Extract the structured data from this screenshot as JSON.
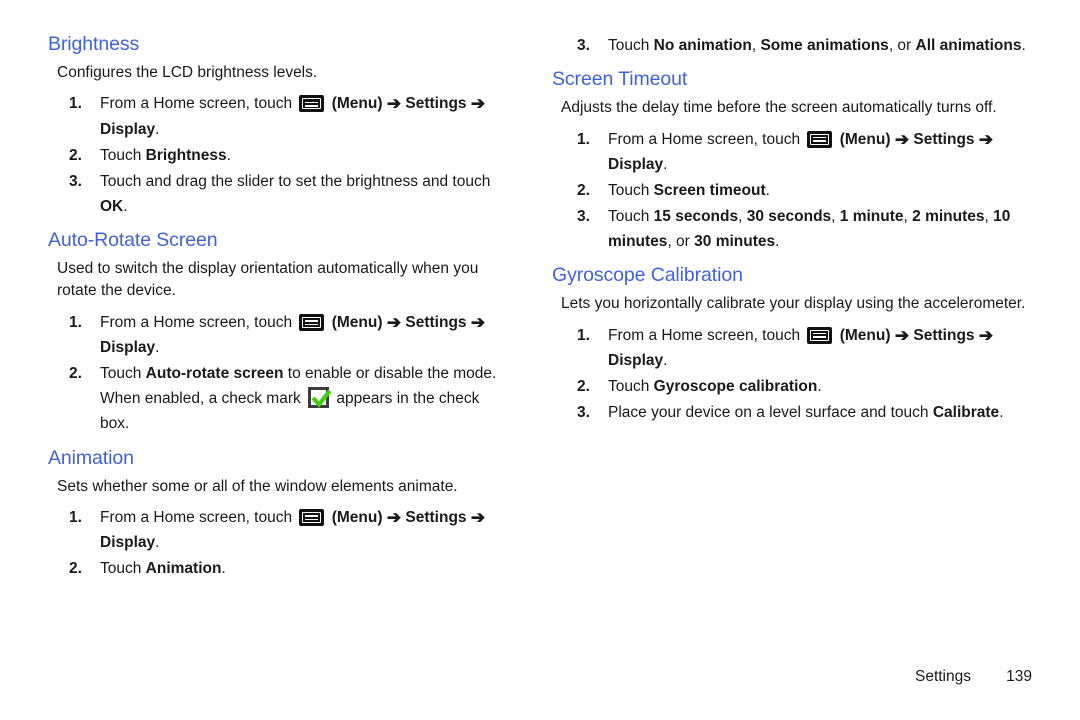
{
  "document": {
    "footer": {
      "section_label": "Settings",
      "page_number": "139"
    },
    "heading_color": "#4062e0",
    "check_color": "#44cc11"
  },
  "icons": {
    "menu": "menu-icon",
    "arrow": "➔",
    "checkbox": "checkbox-checked-icon"
  },
  "left_column": {
    "sections": [
      {
        "heading": "Brightness",
        "description": "Configures the LCD brightness levels.",
        "steps": [
          {
            "num": "1.",
            "parts": [
              {
                "t": "From a Home screen, touch ",
                "b": false
              },
              {
                "t": "ICON_MENU",
                "b": false
              },
              {
                "t": " (Menu) ",
                "b": true
              },
              {
                "t": "ARROW",
                "b": true
              },
              {
                "t": " Settings ",
                "b": true
              },
              {
                "t": "ARROW",
                "b": true
              },
              {
                "t": " Display",
                "b": true
              },
              {
                "t": ".",
                "b": false
              }
            ]
          },
          {
            "num": "2.",
            "parts": [
              {
                "t": "Touch ",
                "b": false
              },
              {
                "t": "Brightness",
                "b": true
              },
              {
                "t": ".",
                "b": false
              }
            ]
          },
          {
            "num": "3.",
            "parts": [
              {
                "t": "Touch and drag the slider to set the brightness and touch ",
                "b": false
              },
              {
                "t": "OK",
                "b": true
              },
              {
                "t": ".",
                "b": false
              }
            ]
          }
        ]
      },
      {
        "heading": "Auto-Rotate Screen",
        "description": "Used to switch the display orientation automatically when you rotate the device.",
        "steps": [
          {
            "num": "1.",
            "parts": [
              {
                "t": "From a Home screen, touch ",
                "b": false
              },
              {
                "t": "ICON_MENU",
                "b": false
              },
              {
                "t": " (Menu) ",
                "b": true
              },
              {
                "t": "ARROW",
                "b": true
              },
              {
                "t": " Settings ",
                "b": true
              },
              {
                "t": "ARROW",
                "b": true
              },
              {
                "t": " Display",
                "b": true
              },
              {
                "t": ".",
                "b": false
              }
            ]
          },
          {
            "num": "2.",
            "parts": [
              {
                "t": "Touch ",
                "b": false
              },
              {
                "t": "Auto-rotate screen",
                "b": true
              },
              {
                "t": " to enable or disable the mode. When enabled, a check mark ",
                "b": false
              },
              {
                "t": "ICON_CHECK",
                "b": false
              },
              {
                "t": " appears in the check box.",
                "b": false
              }
            ]
          }
        ]
      },
      {
        "heading": "Animation",
        "description": "Sets whether some or all of the window elements animate.",
        "steps": [
          {
            "num": "1.",
            "parts": [
              {
                "t": "From a Home screen, touch ",
                "b": false
              },
              {
                "t": "ICON_MENU",
                "b": false
              },
              {
                "t": " (Menu) ",
                "b": true
              },
              {
                "t": "ARROW",
                "b": true
              },
              {
                "t": " Settings ",
                "b": true
              },
              {
                "t": "ARROW",
                "b": true
              },
              {
                "t": " Display",
                "b": true
              },
              {
                "t": ".",
                "b": false
              }
            ]
          },
          {
            "num": "2.",
            "parts": [
              {
                "t": "Touch ",
                "b": false
              },
              {
                "t": "Animation",
                "b": true
              },
              {
                "t": ".",
                "b": false
              }
            ]
          }
        ]
      }
    ]
  },
  "right_column": {
    "continued_step": {
      "num": "3.",
      "parts": [
        {
          "t": "Touch ",
          "b": false
        },
        {
          "t": "No animation",
          "b": true
        },
        {
          "t": ", ",
          "b": false
        },
        {
          "t": "Some animations",
          "b": true
        },
        {
          "t": ", or ",
          "b": false
        },
        {
          "t": "All animations",
          "b": true
        },
        {
          "t": ".",
          "b": false
        }
      ]
    },
    "sections": [
      {
        "heading": "Screen Timeout",
        "description": "Adjusts the delay time before the screen automatically turns off.",
        "steps": [
          {
            "num": "1.",
            "parts": [
              {
                "t": "From a Home screen, touch ",
                "b": false
              },
              {
                "t": "ICON_MENU",
                "b": false
              },
              {
                "t": " (Menu) ",
                "b": true
              },
              {
                "t": "ARROW",
                "b": true
              },
              {
                "t": " Settings ",
                "b": true
              },
              {
                "t": "ARROW",
                "b": true
              },
              {
                "t": " Display",
                "b": true
              },
              {
                "t": ".",
                "b": false
              }
            ]
          },
          {
            "num": "2.",
            "parts": [
              {
                "t": "Touch ",
                "b": false
              },
              {
                "t": "Screen timeout",
                "b": true
              },
              {
                "t": ".",
                "b": false
              }
            ]
          },
          {
            "num": "3.",
            "parts": [
              {
                "t": "Touch ",
                "b": false
              },
              {
                "t": "15 seconds",
                "b": true
              },
              {
                "t": ", ",
                "b": false
              },
              {
                "t": "30 seconds",
                "b": true
              },
              {
                "t": ", ",
                "b": false
              },
              {
                "t": "1 minute",
                "b": true
              },
              {
                "t": ", ",
                "b": false
              },
              {
                "t": "2 minutes",
                "b": true
              },
              {
                "t": ", ",
                "b": false
              },
              {
                "t": "10 minutes",
                "b": true
              },
              {
                "t": ", or ",
                "b": false
              },
              {
                "t": "30 minutes",
                "b": true
              },
              {
                "t": ".",
                "b": false
              }
            ]
          }
        ]
      },
      {
        "heading": "Gyroscope Calibration",
        "description": "Lets you horizontally calibrate your display using the accelerometer.",
        "steps": [
          {
            "num": "1.",
            "parts": [
              {
                "t": "From a Home screen, touch ",
                "b": false
              },
              {
                "t": "ICON_MENU",
                "b": false
              },
              {
                "t": " (Menu) ",
                "b": true
              },
              {
                "t": "ARROW",
                "b": true
              },
              {
                "t": " Settings ",
                "b": true
              },
              {
                "t": "ARROW",
                "b": true
              },
              {
                "t": " Display",
                "b": true
              },
              {
                "t": ".",
                "b": false
              }
            ]
          },
          {
            "num": "2.",
            "parts": [
              {
                "t": "Touch ",
                "b": false
              },
              {
                "t": "Gyroscope calibration",
                "b": true
              },
              {
                "t": ".",
                "b": false
              }
            ]
          },
          {
            "num": "3.",
            "parts": [
              {
                "t": "Place your device on a level surface and touch ",
                "b": false
              },
              {
                "t": "Calibrate",
                "b": true
              },
              {
                "t": ".",
                "b": false
              }
            ]
          }
        ]
      }
    ]
  }
}
